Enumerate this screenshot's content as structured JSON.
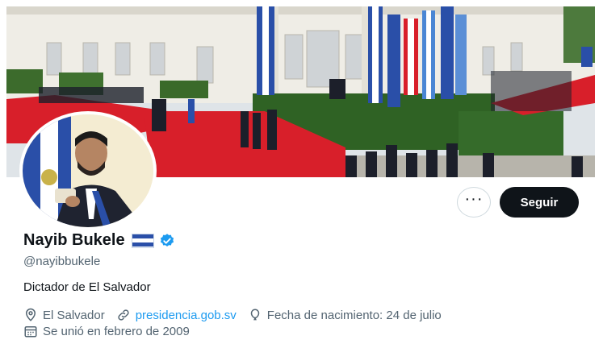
{
  "profile": {
    "name": "Nayib Bukele",
    "handle": "@nayibbukele",
    "bio": "Dictador de El Salvador",
    "location": "El Salvador",
    "website": "presidencia.gob.sv",
    "birthday": "Fecha de nacimiento: 24 de julio",
    "joined": "Se unió en febrero de 2009"
  },
  "actions": {
    "more_label": "···",
    "follow_label": "Seguir"
  },
  "icons": {
    "more": "more-icon",
    "verified": "verified-badge-icon",
    "flag": "el-salvador-flag-icon",
    "location": "location-pin-icon",
    "link": "link-icon",
    "birthday": "balloon-icon",
    "joined": "calendar-icon"
  },
  "colors": {
    "accent": "#1d9bf0",
    "follow_bg": "#0f1419",
    "secondary_text": "#536471",
    "carpet_red": "#d81f2a",
    "flag_blue": "#2a4fa8"
  }
}
